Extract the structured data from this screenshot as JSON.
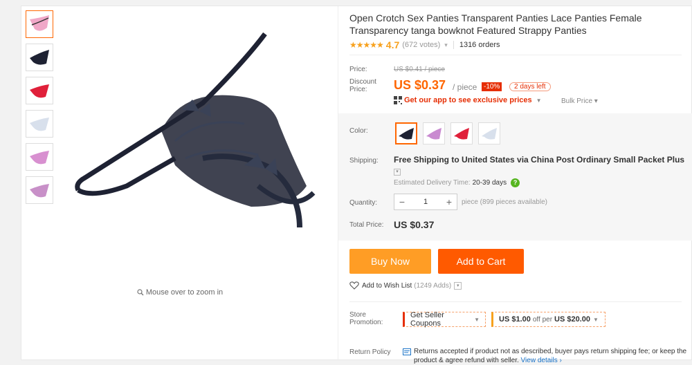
{
  "product": {
    "title": "Open Crotch Sex Panties Transparent Panties Lace Panties Female Transparency tanga bowknot Featured Strappy Panties",
    "rating_score": "4.7",
    "votes": "(672 votes)",
    "orders": "1316 orders"
  },
  "gallery": {
    "zoom_hint": "Mouse over to zoom in",
    "thumbnail_colors": [
      "#f0a8c8",
      "#1e2233",
      "#e0203a",
      "#d8e0ec",
      "#d890d0",
      "#c890c8"
    ]
  },
  "pricing": {
    "price_label": "Price:",
    "old_price": "US $0.41 / piece",
    "discount_label": "Discount Price:",
    "price": "US $0.37",
    "per_piece": "/ piece",
    "discount_badge": "-10%",
    "days_left": "2 days left",
    "app_promo": "Get our app to see exclusive prices",
    "bulk_price": "Bulk Price ▾"
  },
  "options": {
    "color_label": "Color:",
    "colors": [
      "#1e2233",
      "#c98ad0",
      "#e0203a",
      "#d8e0ec"
    ],
    "shipping_label": "Shipping:",
    "shipping_text": "Free Shipping to United States via China Post Ordinary Small Packet Plus",
    "delivery_label": "Estimated Delivery Time:",
    "delivery_days": "20-39 days",
    "quantity_label": "Quantity:",
    "quantity": "1",
    "pieces_available": "piece (899 pieces available)",
    "total_label": "Total Price:",
    "total": "US $0.37"
  },
  "actions": {
    "buy_now": "Buy Now",
    "add_to_cart": "Add to Cart",
    "wish_list": "Add to Wish List",
    "wish_count": "(1249 Adds)"
  },
  "store": {
    "promotion_label": "Store Promotion:",
    "seller_coupons": "Get Seller Coupons",
    "coupon_amount": "US $1.00",
    "coupon_off_per": "off per",
    "coupon_min": "US $20.00",
    "return_label": "Return Policy",
    "return_text": "Returns accepted if product not as described, buyer pays return shipping fee; or keep the product & agree refund with seller.",
    "view_details": "View details ›"
  },
  "colors": {
    "accent": "#ff6600",
    "buy_now": "#ff9d25",
    "add_to_cart": "#ff5a00",
    "discount": "#e62e04",
    "stars": "#f7a11d"
  }
}
